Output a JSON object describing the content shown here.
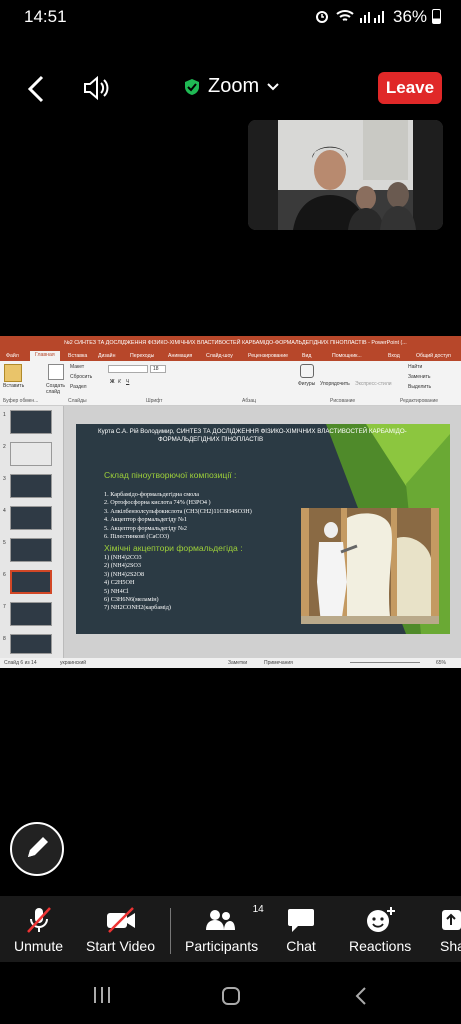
{
  "status": {
    "time": "14:51",
    "battery": "36%"
  },
  "topbar": {
    "title": "Zoom",
    "leave": "Leave",
    "icons": [
      "back-arrow-icon",
      "speaker-icon",
      "shield-check-icon",
      "chevron-down-icon"
    ]
  },
  "shared": {
    "window_title": "№2 СИНТЕЗ ТА ДОСЛІДЖЕННЯ ФІЗИКО-ХІМІЧНИХ ВЛАСТИВОСТЕЙ КАРБАМІДО-ФОРМАЛЬДЕГІДНИХ ПІНОПЛАСТІВ - PowerPoint (...",
    "tabs": [
      "Файл",
      "Главная",
      "Вставка",
      "Дизайн",
      "Переходы",
      "Анимация",
      "Слайд-шоу",
      "Рецензирование",
      "Вид",
      "Помощник...",
      "Вход",
      "Общий доступ"
    ],
    "ribbon": {
      "paste": "Вставить",
      "create_slide": "Создать слайд",
      "layout": "Макет",
      "reset": "Сбросить",
      "section": "Раздел",
      "font_size": "18",
      "find": "Найти",
      "replace": "Заменить",
      "select": "Выделить",
      "shapes": "Фигуры",
      "arrange": "Упорядочить",
      "express": "Экспресс-стили",
      "groups": [
        "Буфер обмен...",
        "Слайды",
        "Шрифт",
        "Абзац",
        "Рисование",
        "Редактирование"
      ]
    },
    "slide": {
      "header_a": "Курта С.А. Рій Володимир, СИНТЕЗ ТА ДОСЛІДЖЕННЯ ФІЗИКО-ХІМІЧНИХ ВЛАСТИВОСТЕЙ КАРБАМІДО-",
      "header_b": "ФОРМАЛЬДЕГІДНИХ ПІНОПЛАСТІВ",
      "heading1": "Склад піноутворючої композиції :",
      "list1": [
        "1. Карбамідо-формальдегідна смола",
        "2. Ортофосфорна кислота 74% (H3PO4 )",
        "3. Алкілбензолсульфокислота (CH3(CH2)11C6H4SO3H)",
        "4. Акцептор формальдегіду №1",
        "5. Акцептор формальдегіду №2",
        "6. Пілестинкові (CaCO3)"
      ],
      "heading2": "Хімічні акцептори формальдегіда :",
      "list2": [
        "1) (NH4)2CO3",
        "2) (NH4)2SO3",
        "3) (NH4)2S2O8",
        "4) C2H5OH",
        "5) NH4Cl",
        "6) C3H6N6(меламін)",
        "7) NH2CONH2(карбамід)"
      ]
    },
    "statusline": {
      "slide": "Слайд 6 из 14",
      "lang": "украинский",
      "notes": "Заметки",
      "comments": "Примечания",
      "zoom": "65%"
    },
    "thumb_numbers": [
      "1",
      "2",
      "3",
      "4",
      "5",
      "6",
      "7",
      "8"
    ]
  },
  "toolbar": [
    {
      "label": "Unmute",
      "icon": "mic-muted-icon"
    },
    {
      "label": "Start Video",
      "icon": "video-off-icon"
    },
    {
      "label": "Participants",
      "icon": "participants-icon",
      "count": "14"
    },
    {
      "label": "Chat",
      "icon": "chat-icon"
    },
    {
      "label": "Reactions",
      "icon": "reactions-icon"
    },
    {
      "label": "Sha",
      "icon": "share-icon"
    }
  ]
}
